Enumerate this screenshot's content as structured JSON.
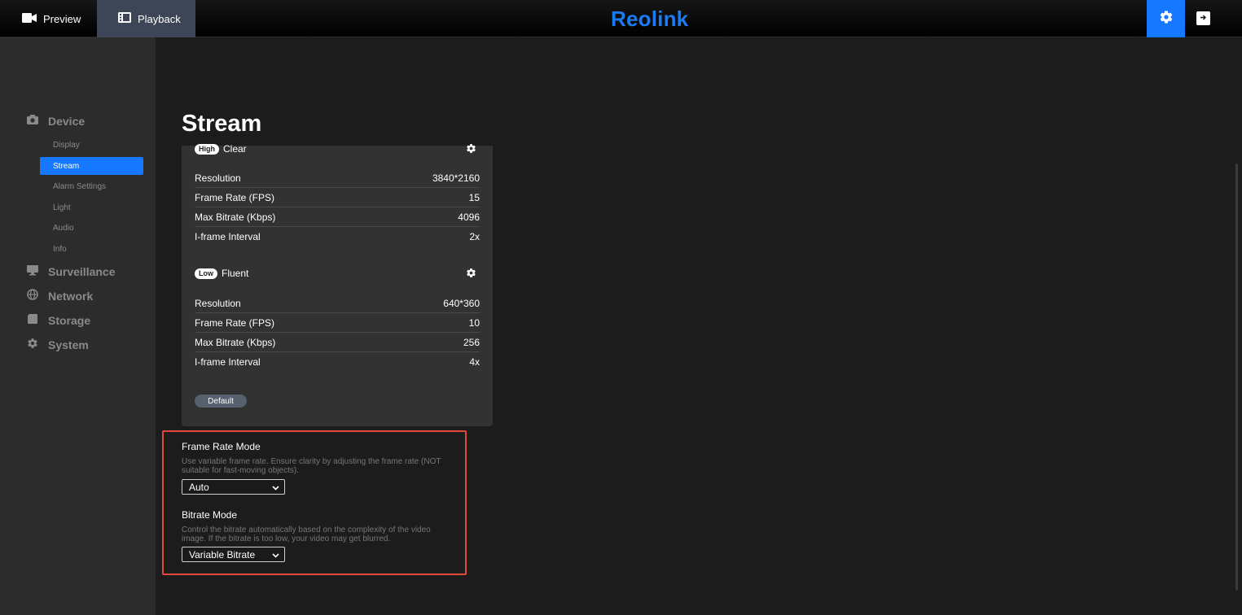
{
  "topbar": {
    "preview_label": "Preview",
    "playback_label": "Playback",
    "brand": "Reolink",
    "accent": "#1677ff"
  },
  "sidebar": {
    "groups": [
      {
        "label": "Device",
        "icon": "camera-icon"
      },
      {
        "label": "Surveillance",
        "icon": "monitor-icon"
      },
      {
        "label": "Network",
        "icon": "globe-icon"
      },
      {
        "label": "Storage",
        "icon": "storage-icon"
      },
      {
        "label": "System",
        "icon": "gear-icon"
      }
    ],
    "device_items": [
      "Display",
      "Stream",
      "Alarm Settings",
      "Light",
      "Audio",
      "Info"
    ],
    "active_item": "Stream"
  },
  "main": {
    "title": "Stream",
    "clear": {
      "badge": "High",
      "name": "Clear",
      "rows": [
        {
          "label": "Resolution",
          "value": "3840*2160"
        },
        {
          "label": "Frame Rate (FPS)",
          "value": "15"
        },
        {
          "label": "Max Bitrate (Kbps)",
          "value": "4096"
        },
        {
          "label": "I-frame Interval",
          "value": "2x"
        }
      ]
    },
    "fluent": {
      "badge": "Low",
      "name": "Fluent",
      "rows": [
        {
          "label": "Resolution",
          "value": "640*360"
        },
        {
          "label": "Frame Rate (FPS)",
          "value": "10"
        },
        {
          "label": "Max Bitrate (Kbps)",
          "value": "256"
        },
        {
          "label": "I-frame Interval",
          "value": "4x"
        }
      ]
    },
    "default_label": "Default",
    "frame_rate_mode": {
      "title": "Frame Rate Mode",
      "desc": "Use variable frame rate. Ensure clarity by adjusting the frame rate (NOT suitable for fast-moving objects).",
      "value": "Auto"
    },
    "bitrate_mode": {
      "title": "Bitrate Mode",
      "desc": "Control the bitrate automatically based on the complexity of the video image. If the bitrate is too low, your video may get blurred.",
      "value": "Variable Bitrate"
    }
  }
}
